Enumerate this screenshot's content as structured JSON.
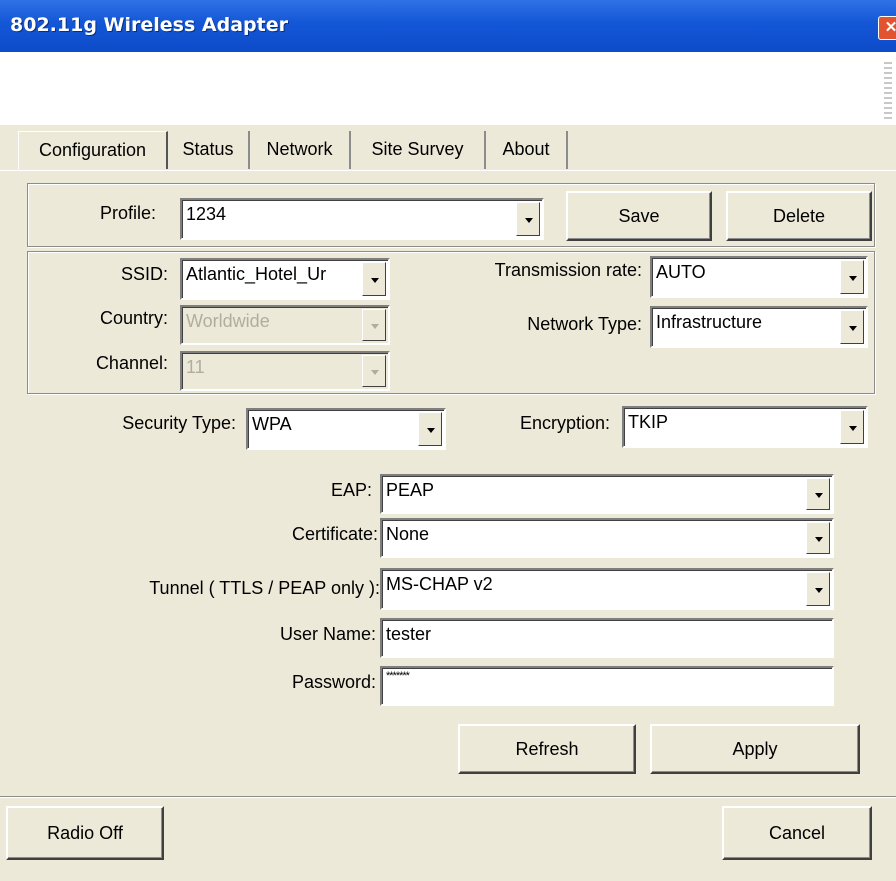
{
  "window": {
    "title": "802.11g Wireless Adapter",
    "close_glyph": "✕"
  },
  "tabs": [
    "Configuration",
    "Status",
    "Network",
    "Site Survey",
    "About"
  ],
  "profile": {
    "label": "Profile:",
    "value": "1234",
    "save_label": "Save",
    "delete_label": "Delete"
  },
  "wireless": {
    "ssid_label": "SSID:",
    "ssid_value": "Atlantic_Hotel_Ur",
    "country_label": "Country:",
    "country_value": "Worldwide",
    "channel_label": "Channel:",
    "channel_value": "11",
    "rate_label": "Transmission rate:",
    "rate_value": "AUTO",
    "nettype_label": "Network Type:",
    "nettype_value": "Infrastructure"
  },
  "security": {
    "type_label": "Security Type:",
    "type_value": "WPA",
    "encryption_label": "Encryption:",
    "encryption_value": "TKIP",
    "eap_label": "EAP:",
    "eap_value": "PEAP",
    "certificate_label": "Certificate:",
    "certificate_value": "None",
    "tunnel_label": "Tunnel ( TTLS / PEAP only ):",
    "tunnel_value": "MS-CHAP v2",
    "username_label": "User Name:",
    "username_value": "tester",
    "password_label": "Password:",
    "password_value": "*******"
  },
  "actions": {
    "refresh_label": "Refresh",
    "apply_label": "Apply",
    "radio_off_label": "Radio Off",
    "cancel_label": "Cancel"
  }
}
